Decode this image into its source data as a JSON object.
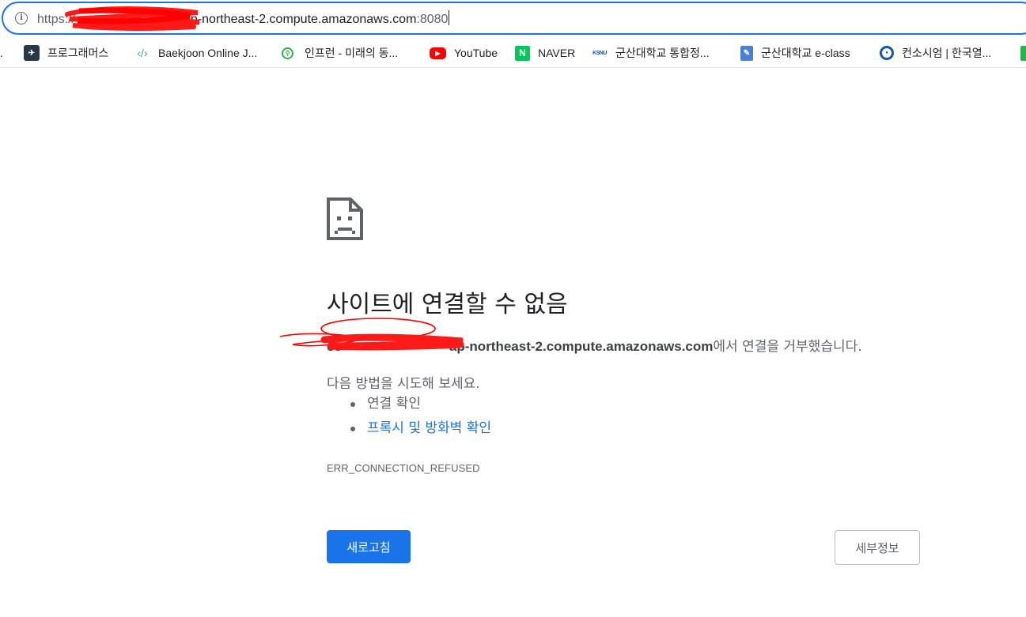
{
  "address_bar": {
    "scheme": "https://",
    "host_visible": "ap-northeast-2.compute.amazonaws.com",
    "port": ":8080"
  },
  "bookmarks": [
    {
      "label": "프로그래머스",
      "icon": "programmers-icon"
    },
    {
      "label": "Baekjoon Online J...",
      "icon": "code-brackets-icon"
    },
    {
      "label": "인프런 - 미래의 동...",
      "icon": "inflearn-icon"
    },
    {
      "label": "YouTube",
      "icon": "youtube-icon"
    },
    {
      "label": "NAVER",
      "icon": "naver-icon"
    },
    {
      "label": "군산대학교 통합정...",
      "icon": "ksnu-icon"
    },
    {
      "label": "군산대학교 e-class",
      "icon": "eclass-notepad-icon"
    },
    {
      "label": "컨소시엄 | 한국열...",
      "icon": "consortium-icon"
    }
  ],
  "error": {
    "title": "사이트에 연결할 수 없음",
    "host": "ap-northeast-2.compute.amazonaws.com",
    "host_prefix": "ec",
    "refused_suffix": "에서 연결을 거부했습니다.",
    "try_text": "다음 방법을 시도해 보세요.",
    "suggestions": [
      "연결 확인",
      "프록시 및 방화벽 확인"
    ],
    "code": "ERR_CONNECTION_REFUSED"
  },
  "buttons": {
    "reload": "새로고침",
    "details": "세부정보"
  },
  "colors": {
    "accent": "#1a73e8",
    "redaction": "#ff0000"
  }
}
